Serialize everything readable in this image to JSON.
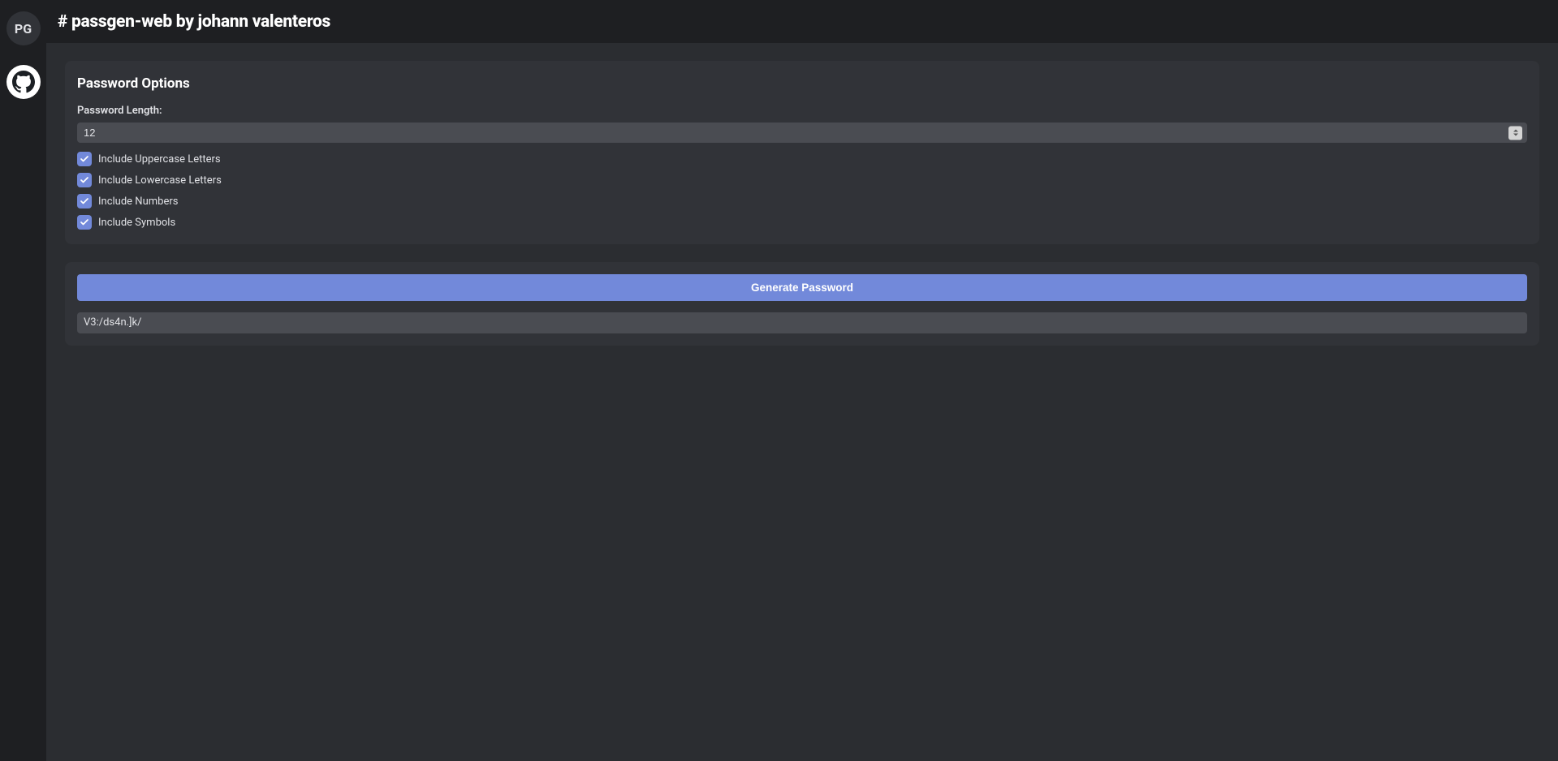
{
  "sidebar": {
    "pg_label": "PG"
  },
  "header": {
    "title": "# passgen-web by johann valenteros"
  },
  "options": {
    "card_title": "Password Options",
    "length_label": "Password Length:",
    "length_value": "12",
    "checkboxes": [
      {
        "label": "Include Uppercase Letters",
        "checked": true
      },
      {
        "label": "Include Lowercase Letters",
        "checked": true
      },
      {
        "label": "Include Numbers",
        "checked": true
      },
      {
        "label": "Include Symbols",
        "checked": true
      }
    ]
  },
  "generate": {
    "button_label": "Generate Password",
    "output_value": "V3:/ds4n.]k/"
  }
}
